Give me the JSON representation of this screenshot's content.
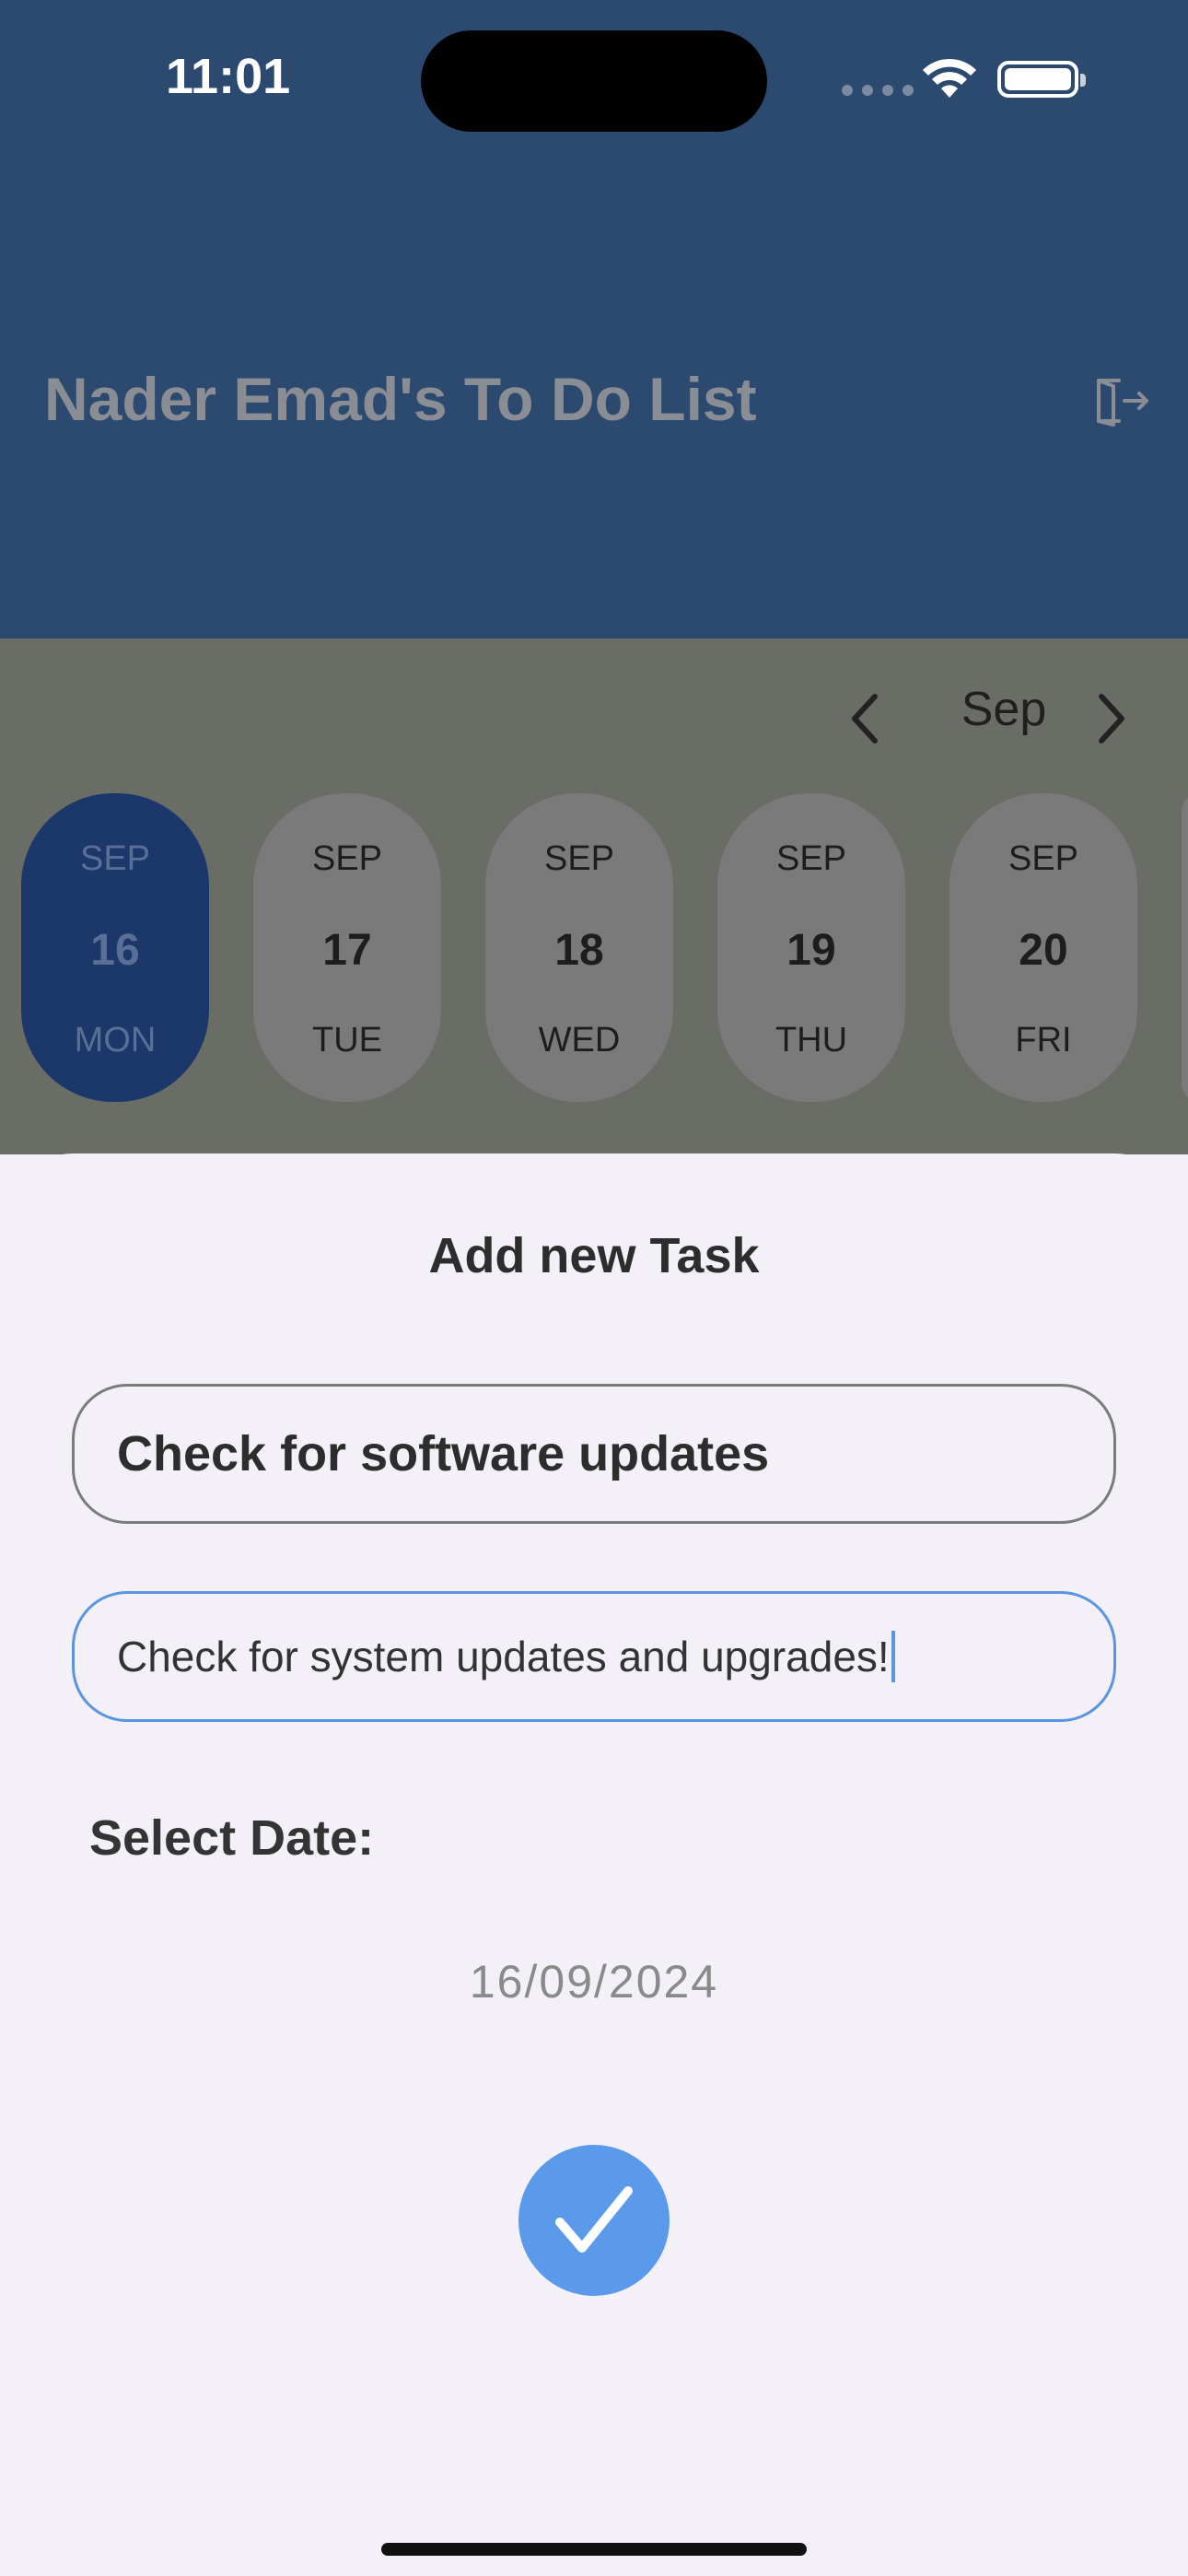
{
  "status_bar": {
    "time": "11:01"
  },
  "header": {
    "title": "Nader Emad's To Do List",
    "logout_icon": "logout-icon"
  },
  "calendar": {
    "month": "Sep",
    "days": [
      {
        "month": "SEP",
        "day": "16",
        "weekday": "MON",
        "selected": true
      },
      {
        "month": "SEP",
        "day": "17",
        "weekday": "TUE",
        "selected": false
      },
      {
        "month": "SEP",
        "day": "18",
        "weekday": "WED",
        "selected": false
      },
      {
        "month": "SEP",
        "day": "19",
        "weekday": "THU",
        "selected": false
      },
      {
        "month": "SEP",
        "day": "20",
        "weekday": "FRI",
        "selected": false
      }
    ]
  },
  "sheet": {
    "title": "Add new Task",
    "task_title_value": "Check for software updates",
    "task_description_value": "Check for system updates and upgrades!",
    "date_label": "Select Date:",
    "date_value": "16/09/2024",
    "confirm_icon": "check-icon"
  },
  "colors": {
    "accent": "#5b9aea",
    "header_bg": "#2c4a70",
    "selected_day": "#1c3769"
  }
}
